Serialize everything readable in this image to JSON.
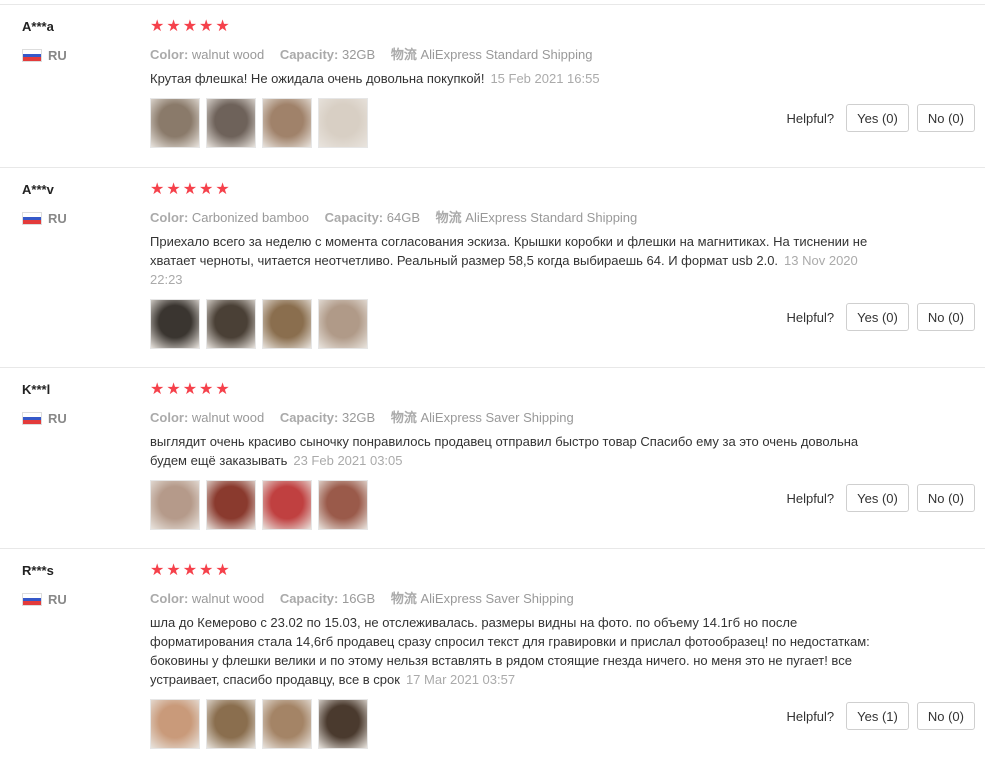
{
  "labels": {
    "color": "Color:",
    "capacity": "Capacity:",
    "shipping_prefix": "物流",
    "helpful": "Helpful?"
  },
  "reviews": [
    {
      "user": "A***a",
      "country": "RU",
      "color": "walnut wood",
      "capacity": "32GB",
      "shipping": "AliExpress Standard Shipping",
      "text": "Крутая флешка! Не ожидала очень довольна покупкой!",
      "date": "15 Feb 2021 16:55",
      "yes": "Yes (0)",
      "no": "No (0)",
      "thumb_colors": [
        "#8a7a6a",
        "#6e625a",
        "#a0826a",
        "#d8cfc4"
      ]
    },
    {
      "user": "A***v",
      "country": "RU",
      "color": "Carbonized bamboo",
      "capacity": "64GB",
      "shipping": "AliExpress Standard Shipping",
      "text": "Приехало всего за неделю с момента согласования эскиза. Крышки коробки и флешки на магнитиках. На тиснении не хватает черноты, читается неотчетливо. Реальный размер 58,5 когда выбираешь 64. И формат usb 2.0.",
      "date": "13 Nov 2020 22:23",
      "yes": "Yes (0)",
      "no": "No (0)",
      "thumb_colors": [
        "#3a3530",
        "#4a4036",
        "#8a6e4e",
        "#b09a88"
      ]
    },
    {
      "user": "K***l",
      "country": "RU",
      "color": "walnut wood",
      "capacity": "32GB",
      "shipping": "AliExpress Saver Shipping",
      "text": "выглядит очень красиво сыночку понравилось продавец отправил быстро товар Спасибо ему за это очень довольна будем ещё заказывать",
      "date": "23 Feb 2021 03:05",
      "yes": "Yes (0)",
      "no": "No (0)",
      "thumb_colors": [
        "#b59a8a",
        "#8a3a2e",
        "#c04040",
        "#9a5a4a"
      ]
    },
    {
      "user": "R***s",
      "country": "RU",
      "color": "walnut wood",
      "capacity": "16GB",
      "shipping": "AliExpress Saver Shipping",
      "text": "шла до Кемерово с 23.02 по 15.03, не отслеживалась. размеры видны на фото. по объему 14.1гб но после форматирования стала 14,6гб продавец сразу спросил текст для гравировки и прислал фотообразец! по недостаткам: боковины у флешки велики и по этому нельзя вставлять в рядом стоящие гнезда ничего. но меня это не пугает! все устраивает, спасибо продавцу, все в срок",
      "date": "17 Mar 2021 03:57",
      "yes": "Yes (1)",
      "no": "No (0)",
      "thumb_colors": [
        "#c99a7a",
        "#8a6e4e",
        "#a48466",
        "#4a3a2e"
      ]
    }
  ]
}
